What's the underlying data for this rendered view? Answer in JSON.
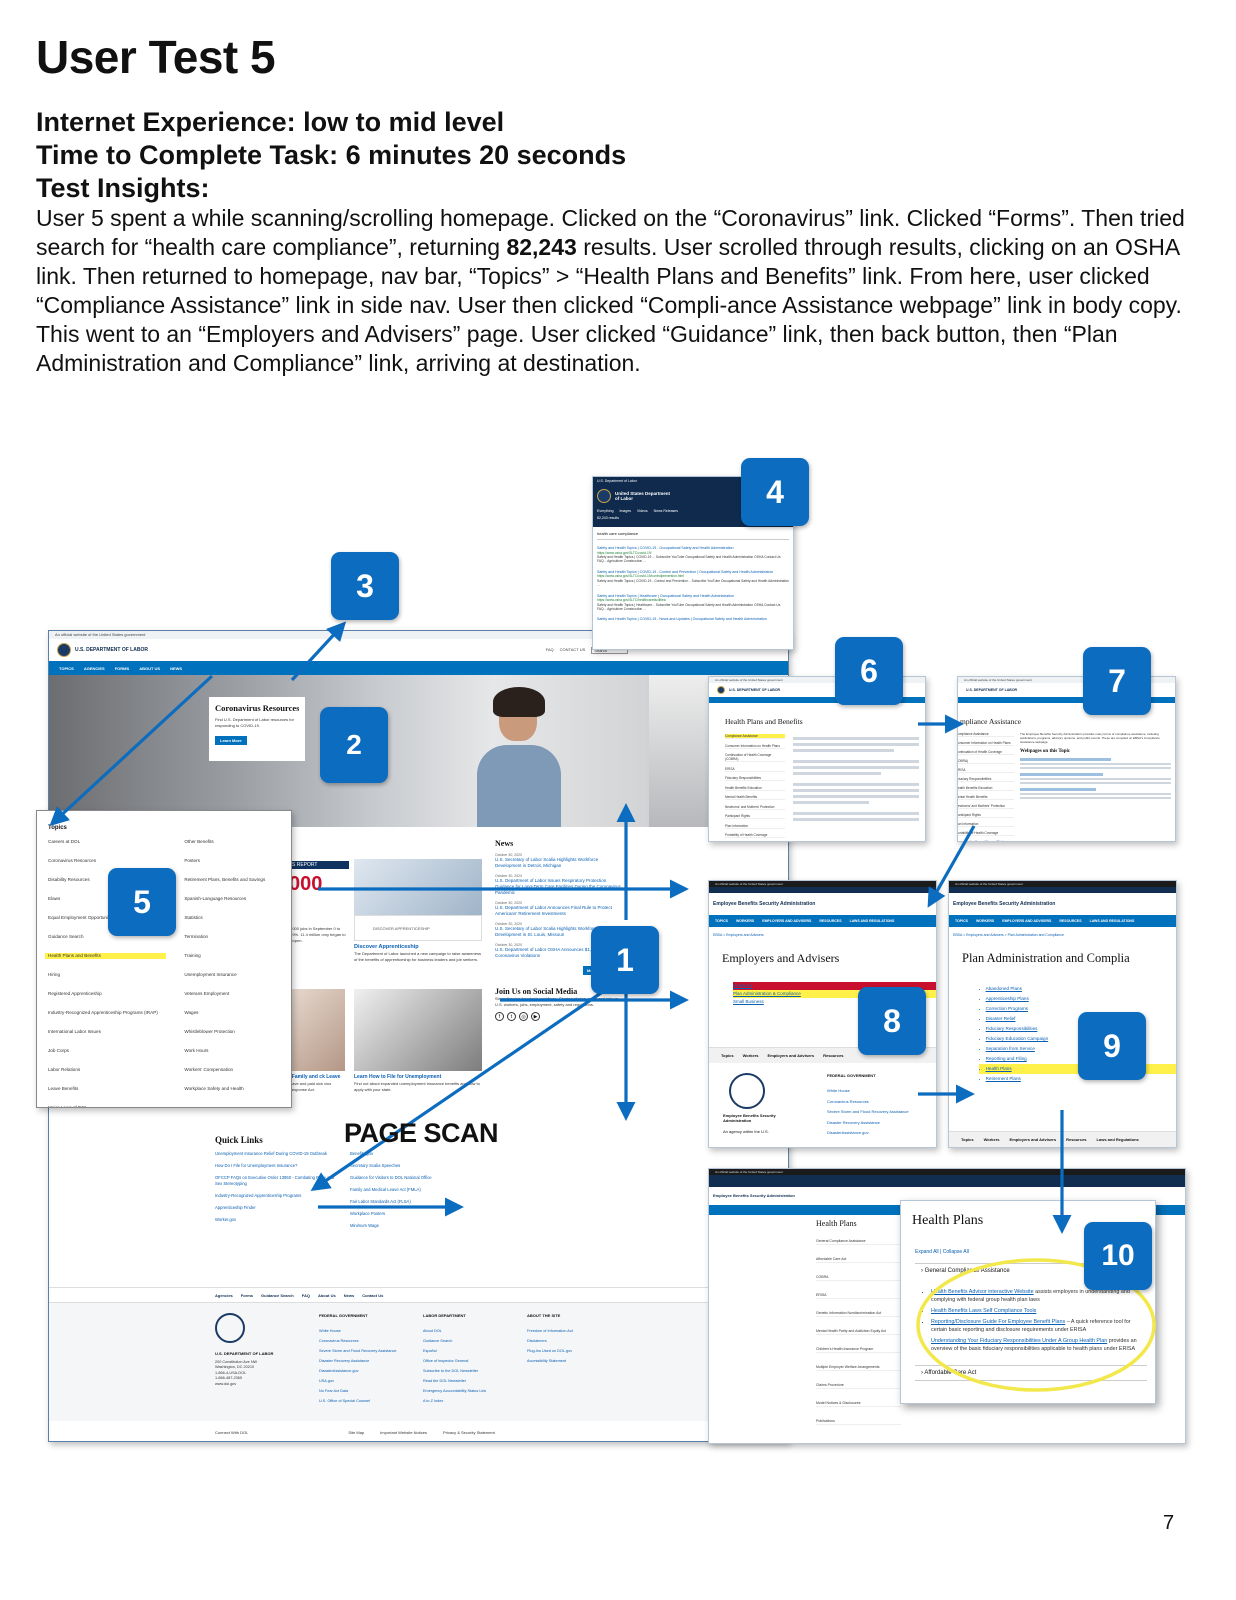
{
  "title": "User Test 5",
  "meta": {
    "experience": "Internet Experience: low to mid level",
    "time": "Time to Complete Task: 6 minutes 20 seconds",
    "insights_heading": "Test Insights:"
  },
  "insights": {
    "part1": "User 5 spent a while scanning/scrolling homepage. Clicked on the “Coronavirus” link. Clicked “Forms”. Then tried search for “health care compliance”, returning ",
    "count": "82,243",
    "part2": " results. User scrolled through results, clicking on an OSHA link. Then returned to homepage, nav bar, “Topics” > “Health Plans and Benefits” link. From here, user clicked “Compliance Assistance” link in side nav. User then clicked “Compli-ance Assistance webpage” link in body copy. This went to an “Employers and Advisers” page. User clicked “Guidance” link, then back button, then “Plan Administration and Compliance” link, arriving at destination."
  },
  "page_scan_label": "PAGE SCAN",
  "page_number": "7",
  "badges": [
    "1",
    "2",
    "3",
    "4",
    "5",
    "6",
    "7",
    "8",
    "9",
    "10"
  ],
  "homepage": {
    "gov_banner": "An official website of the United States government",
    "brand": "U.S. DEPARTMENT OF LABOR",
    "util": [
      "FAQ",
      "CONTACT US"
    ],
    "search_placeholder": "Search",
    "nav": [
      "TOPICS",
      "AGENCIES",
      "FORMS",
      "ABOUT US",
      "NEWS"
    ],
    "hero_title": "Coronavirus Resources",
    "hero_text": "Find U.S. Department of Labor resources for responding to COVID-19.",
    "hero_button": "Learn More",
    "report_label": "S REPORT",
    "report_big": "000",
    "apprentice_title": "Discover Apprenticeship",
    "apprentice_text": "The Department of Labor launched a new campaign to raise awareness of the benefits of apprenticeship for business leaders and job seekers.",
    "apprentice_logo": "DISCOVER APPRENTICESHIP",
    "jobs_text": "1,000 jobs in September 0 to 7.9%. 11.4 million omy began to reopen.",
    "family_title": "l Family and ck Leave",
    "family_text": "leave and paid sick vius Response Act.",
    "unemp_title": "Learn How to File for Unemployment",
    "unemp_text": "Find out about expanded unemployment insurance benefits and how to apply with your state.",
    "news_heading": "News",
    "news": [
      {
        "date": "October 30, 2020",
        "title": "U.S. Secretary of Labor Scalia Highlights Workforce Development in Detroit, Michigan"
      },
      {
        "date": "October 30, 2020",
        "title": "U.S. Department of Labor Issues Respiratory Protection Guidance for Long-Term Care Facilities During the Coronavirus Pandemic"
      },
      {
        "date": "October 30, 2020",
        "title": "U.S. Department of Labor Announces Final Rule to Protect Americans’ Retirement Investments"
      },
      {
        "date": "October 30, 2020",
        "title": "U.S. Secretary of Labor Scalia Highlights Workforce Development in St. Louis, Missouri"
      },
      {
        "date": "October 30, 2020",
        "title": "U.S. Department of Labor OSHA Announces $1,025,459 in Coronavirus Violations"
      }
    ],
    "more_news": "More News",
    "social_heading": "Join Us on Social Media",
    "social_text": "Strengthening America’s workforce. Sharing stories, news and info on U.S. workers, jobs, employment, safety and regulations.",
    "quick_links_heading": "Quick Links",
    "quick_links": [
      "Unemployment Insurance Relief During COVID-19 Outbreak",
      "How Do I File for Unemployment Insurance?",
      "OFCCP FAQs on Executive Order 13950 - Combating Race and Sex Stereotyping",
      "Industry-Recognized Apprenticeship Programs",
      "Apprenticeship Finder",
      "Worker.gov"
    ],
    "quick_links_right": [
      "Benefits.gov",
      "Secretary Scalia Speeches",
      "Guidance for Visitors to DOL National Office",
      "Family and Medical Leave Act (FMLA)",
      "Fair Labor Standards Act (FLSA)",
      "Workplace Posters",
      "Minimum Wage"
    ],
    "footer_nav": [
      "Agencies",
      "Forms",
      "Guidance Search",
      "FAQ",
      "About Us",
      "News",
      "Contact Us"
    ],
    "footer_brand": "U.S. DEPARTMENT OF LABOR",
    "footer_address": [
      "200 Constitution Ave NW",
      "Washington, DC 20210",
      "1-866-4-USA-DOL",
      "1-866-487-2365",
      "www.dol.gov"
    ],
    "footer_cols": [
      {
        "heading": "FEDERAL GOVERNMENT",
        "links": [
          "White House",
          "Coronavirus Resources",
          "Severe Storm and Flood Recovery Assistance",
          "Disaster Recovery Assistance",
          "DisasterAssistance.gov",
          "USA.gov",
          "No Fear Act Data",
          "U.S. Office of Special Counsel"
        ]
      },
      {
        "heading": "LABOR DEPARTMENT",
        "links": [
          "About DOL",
          "Guidance Search",
          "Español",
          "Office of Inspector General",
          "Subscribe to the DOL Newsletter",
          "Read the DOL Newsletter",
          "Emergency Accountability Status Link",
          "A to Z Index"
        ]
      },
      {
        "heading": "ABOUT THE SITE",
        "links": [
          "Freedom of Information Act",
          "Disclaimers",
          "Plug-Ins Used on DOL.gov",
          "Accessibility Statement"
        ]
      }
    ],
    "connect": "Connect With DOL",
    "bottom_links": [
      "Site Map",
      "Important Website Notices",
      "Privacy & Security Statement"
    ]
  },
  "topics_menu": {
    "heading": "Topics",
    "col1": [
      "Careers at DOL",
      "Coronavirus Resources",
      "Disability Resources",
      "Elaws",
      "Equal Employment Opportunity",
      "Guidance Search",
      "Health Plans and Benefits",
      "Hiring",
      "Registered Apprenticeship",
      "Industry-Recognized Apprenticeship Programs (IRAP)",
      "International Labor Issues",
      "Job Corps",
      "Labor Relations",
      "Leave Benefits",
      "Major Laws of DOL"
    ],
    "col2": [
      "Other Benefits",
      "Posters",
      "Retirement Plans, Benefits and Savings",
      "Spanish-Language Resources",
      "Statistics",
      "Termination",
      "Training",
      "Unemployment Insurance",
      "Veterans Employment",
      "Wages",
      "Whistleblower Protection",
      "Work Hours",
      "Workers' Compensation",
      "Workplace Safety and Health"
    ]
  },
  "search_results": {
    "agency": "U.S. Department of Labor",
    "brand": "United States Department of Labor",
    "tabs": [
      "Everything",
      "Images",
      "Videos",
      "News Releases"
    ],
    "count_text": "82,243 results",
    "query": "health care compliance",
    "results": [
      {
        "title": "Safety and Health Topics | COVID-19 - Occupational Safety and Health Administration",
        "url": "https://www.osha.gov/SLTC/covid-19/",
        "snippet": "Safety and Health Topics | COVID-19 ... Subscribe YouTube Occupational Safety and Health Administration OSHA Contact Us FAQ... Agriculture Construction ..."
      },
      {
        "title": "Safety and Health Topics | COVID-19 - Control and Prevention | Occupational Safety and Health Administration",
        "url": "https://www.osha.gov/SLTC/covid-19/controlprevention.html",
        "snippet": "Safety and Health Topics | COVID-19 - Control and Prevention... Subscribe YouTube Occupational Safety and Health Administration ..."
      },
      {
        "title": "Safety and Health Topics | Healthcare | Occupational Safety and Health Administration",
        "url": "https://www.osha.gov/SLTC/healthcarefacilities/",
        "snippet": "Safety and Health Topics | Healthcare... Subscribe YouTube Occupational Safety and Health Administration OSHA Contact Us FAQ... Agriculture Construction ..."
      },
      {
        "title": "Safety and Health Topics | COVID-19 - News and Updates | Occupational Safety and Health Administration",
        "url": "",
        "snippet": ""
      }
    ]
  },
  "hpb_page": {
    "brand": "U.S. DEPARTMENT OF LABOR",
    "title": "Health Plans and Benefits",
    "side": [
      "Compliance Assistance",
      "Consumer Information on Health Plans",
      "Continuation of Health Coverage (COBRA)",
      "ERISA",
      "Fiduciary Responsibilities",
      "Health Benefits Education",
      "Mental Health Benefits",
      "Newborns' and Mothers' Protection",
      "Participant Rights",
      "Plan Information",
      "Portability of Health Coverage",
      "Women's Health and Cancer Rights"
    ]
  },
  "ca_page": {
    "brand": "U.S. DEPARTMENT OF LABOR",
    "title": "Compliance Assistance",
    "title_visible": "mpliance Assistance",
    "intro": "The Employee Benefits Security Administration provides many forms of compliance assistance, including publications, programs, advisory opinions, and public events. These are compiled on EBSA's Compliance Assistance webpage.",
    "subhead": "Webpages on this Topic",
    "side": [
      "Compliance Assistance",
      "Consumer Information on Health Plans",
      "Continuation of Health Coverage (COBRA)",
      "ERISA",
      "Fiduciary Responsibilities",
      "Health Benefits Education",
      "Mental Health Benefits",
      "Newborns' and Mothers' Protection",
      "Participant Rights",
      "Plan Information",
      "Portability of Health Coverage",
      "Women's Health and Cancer Rights"
    ],
    "side_visible": [
      "ompliance Assistance",
      "onsumer Information on Health Plans",
      "ontinuation of Health Coverage",
      "OBRA)",
      "RISA",
      "duciary Responsibilities",
      "ealth Benefits Education",
      "ental Health Benefits",
      "ewborns' and Mothers' Protection",
      "articipant Rights",
      "an Information",
      "ortability of Health Coverage",
      "omen's Health and Cancer Rights"
    ]
  },
  "ea_page": {
    "agency": "Employee Benefits Security Administration",
    "nav": [
      "TOPICS",
      "WORKERS",
      "EMPLOYERS AND ADVISERS",
      "RESOURCES",
      "LAWS AND REGULATIONS"
    ],
    "breadcrumb": "EBSA > Employers and Advisers",
    "title": "Employers and Advisers",
    "links": [
      "Guidance",
      "Plan Administration & Compliance",
      "Small Business"
    ],
    "bottom_nav": [
      "Topics",
      "Workers",
      "Employers and Advisers",
      "Resources"
    ],
    "agency_line": "Employee Benefits Security Administration",
    "agency_sub": "An agency within the U.S.",
    "fed_heading": "FEDERAL GOVERNMENT",
    "fed_links": [
      "White House",
      "Coronavirus Resources",
      "Severe Storm and Flood Recovery Assistance",
      "Disaster Recovery Assistance",
      "DisasterAssistance.gov"
    ]
  },
  "pac_page": {
    "agency": "Employee Benefits Security Administration",
    "nav": [
      "TOPICS",
      "WORKERS",
      "EMPLOYERS AND ADVISERS",
      "RESOURCES",
      "LAWS AND REGULATIONS"
    ],
    "breadcrumb": "EBSA > Employers and Advisers > Plan Administration and Compliance",
    "title": "Plan Administration and Compliance",
    "title_visible": "Plan Administration and Complia",
    "links": [
      "Abandoned Plans",
      "Apprenticeship Plans",
      "Correction Programs",
      "Disaster Relief",
      "Fiduciary Responsibilities",
      "Fiduciary Education Campaign",
      "Separation from Service",
      "Reporting and Filing",
      "Health Plans",
      "Retirement Plans"
    ],
    "bottom_nav": [
      "Topics",
      "Workers",
      "Employers and Advisers",
      "Resources",
      "Laws and Regulations"
    ]
  },
  "hp_page": {
    "agency": "Employee Benefits Security Administration",
    "title": "Health Plans",
    "expand": "Expand All",
    "collapse": "Collapse All",
    "accordion": "General Compliance Assistance",
    "items": [
      {
        "link": "Health Benefits Advisor interactive Website",
        "text": " assists employers in understanding and complying with federal group health plan laws"
      },
      {
        "link": "Health Benefits Laws Self Compliance Tools",
        "text": ""
      },
      {
        "link": "Reporting/Disclosure Guide For Employee Benefit Plans",
        "text": " – A quick reference tool for certain basic reporting and disclosure requirements under ERISA"
      },
      {
        "link": "Understanding Your Fiduciary Responsibilities Under A Group Health Plan",
        "text": " provides an overview of the basic fiduciary responsibilities applicable to health plans under ERISA"
      }
    ],
    "accordion2": "Affordable Care Act",
    "bg_side": [
      "General Compliance Assistance",
      "Affordable Care Act",
      "COBRA",
      "ERISA",
      "Genetic Information Nondiscrimination Act",
      "Mental Health Parity and Addiction Equity Act",
      "Children's Health Insurance Program",
      "Multiple Employer Welfare Arrangements",
      "Claims Procedure",
      "Model Notices & Disclosures",
      "Publications"
    ]
  },
  "colors": {
    "accent": "#0c6cbf",
    "nav_blue": "#0071bc",
    "navy": "#112e51",
    "highlight": "#fff14a",
    "circle": "#f2e84b"
  }
}
